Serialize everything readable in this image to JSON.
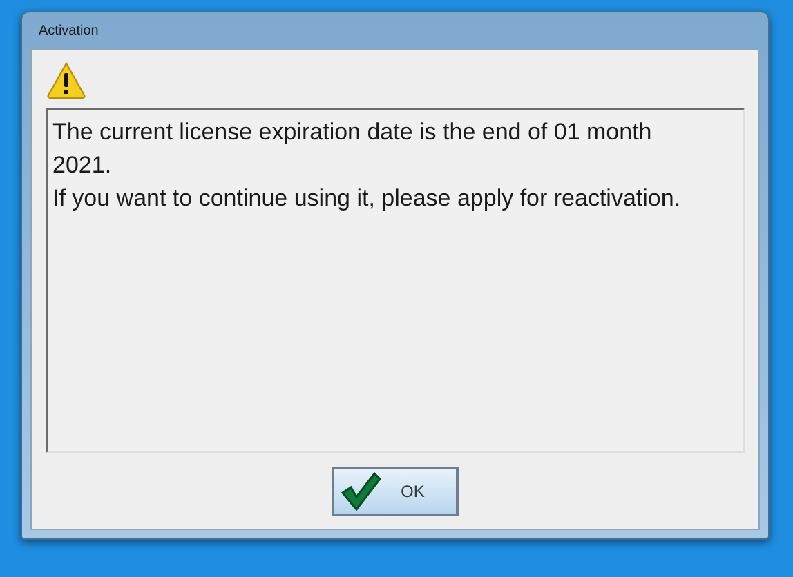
{
  "window": {
    "title": "Activation"
  },
  "message": {
    "lines": [
      "The current license expiration date is the end of 01 month",
      "2021.",
      "If you want to continue using it, please apply for reactivation."
    ]
  },
  "buttons": [
    {
      "label": "OK",
      "kind": "ok"
    }
  ]
}
